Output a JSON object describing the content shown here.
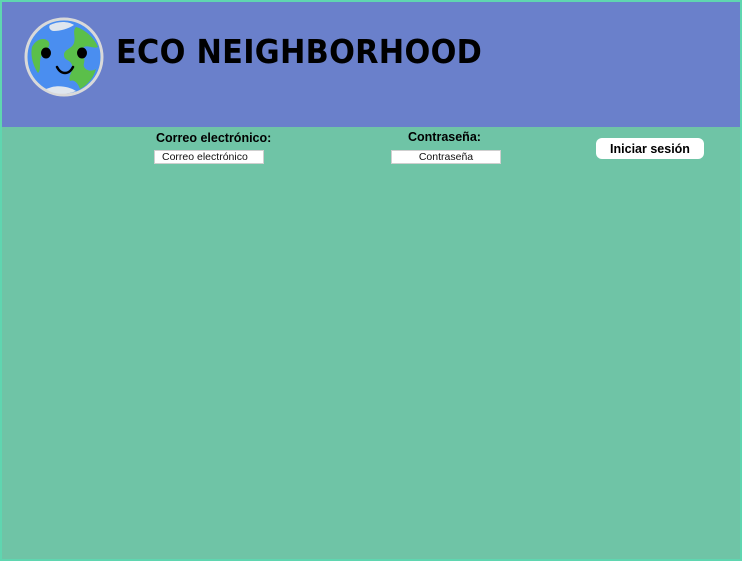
{
  "header": {
    "title": "ECO NEIGHBORHOOD",
    "logo_icon": "smiling-earth-icon",
    "background_color": "#6a80cb"
  },
  "login_form": {
    "email_label": "Correo electrónico:",
    "email_placeholder": "Correo electrónico",
    "email_value": "",
    "password_label": "Contraseña:",
    "password_placeholder": "Contraseña",
    "password_value": "",
    "submit_label": "Iniciar sesión"
  },
  "colors": {
    "page_background": "#6fc4a6",
    "border": "#5fd6b0"
  }
}
